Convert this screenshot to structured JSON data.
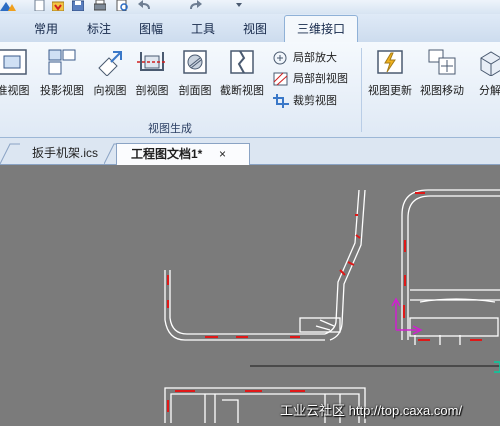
{
  "quick_access": {
    "icons": [
      "app-logo-icon",
      "new-icon",
      "open-icon",
      "save-icon",
      "print-icon",
      "undo-icon",
      "redo-icon",
      "dropdown-icon"
    ]
  },
  "ribbon_tabs": [
    {
      "label": "常用",
      "active": false
    },
    {
      "label": "标注",
      "active": false
    },
    {
      "label": "图幅",
      "active": false
    },
    {
      "label": "工具",
      "active": false
    },
    {
      "label": "视图",
      "active": false
    },
    {
      "label": "三维接口",
      "active": true
    }
  ],
  "ribbon": {
    "buttons": [
      {
        "label": "准视图",
        "icon": "standard-view-icon"
      },
      {
        "label": "投影视图",
        "icon": "projection-view-icon"
      },
      {
        "label": "向视图",
        "icon": "direction-view-icon"
      },
      {
        "label": "剖视图",
        "icon": "section-view-icon"
      },
      {
        "label": "剖面图",
        "icon": "cross-section-icon"
      },
      {
        "label": "截断视图",
        "icon": "broken-view-icon"
      }
    ],
    "small_items": [
      {
        "label": "局部放大",
        "icon": "detail-view-icon"
      },
      {
        "label": "局部剖视图",
        "icon": "local-section-icon"
      },
      {
        "label": "裁剪视图",
        "icon": "crop-view-icon"
      }
    ],
    "group_label": "视图生成",
    "right_buttons": [
      {
        "label": "视图更新",
        "icon": "update-view-icon"
      },
      {
        "label": "视图移动",
        "icon": "move-view-icon"
      },
      {
        "label": "分解",
        "icon": "explode-icon"
      }
    ]
  },
  "doc_tabs": [
    {
      "label": "扳手机架.ics",
      "active": false
    },
    {
      "label": "工程图文档1*",
      "active": true,
      "close": "×"
    }
  ],
  "watermark": "工业云社区 http://top.caxa.com/",
  "colors": {
    "canvas": "#7b7b7b",
    "drawing_line": "#ffffff",
    "hidden_line": "#e01818",
    "axis_magenta": "#d020d0",
    "accent_blue": "#3a78c8"
  }
}
